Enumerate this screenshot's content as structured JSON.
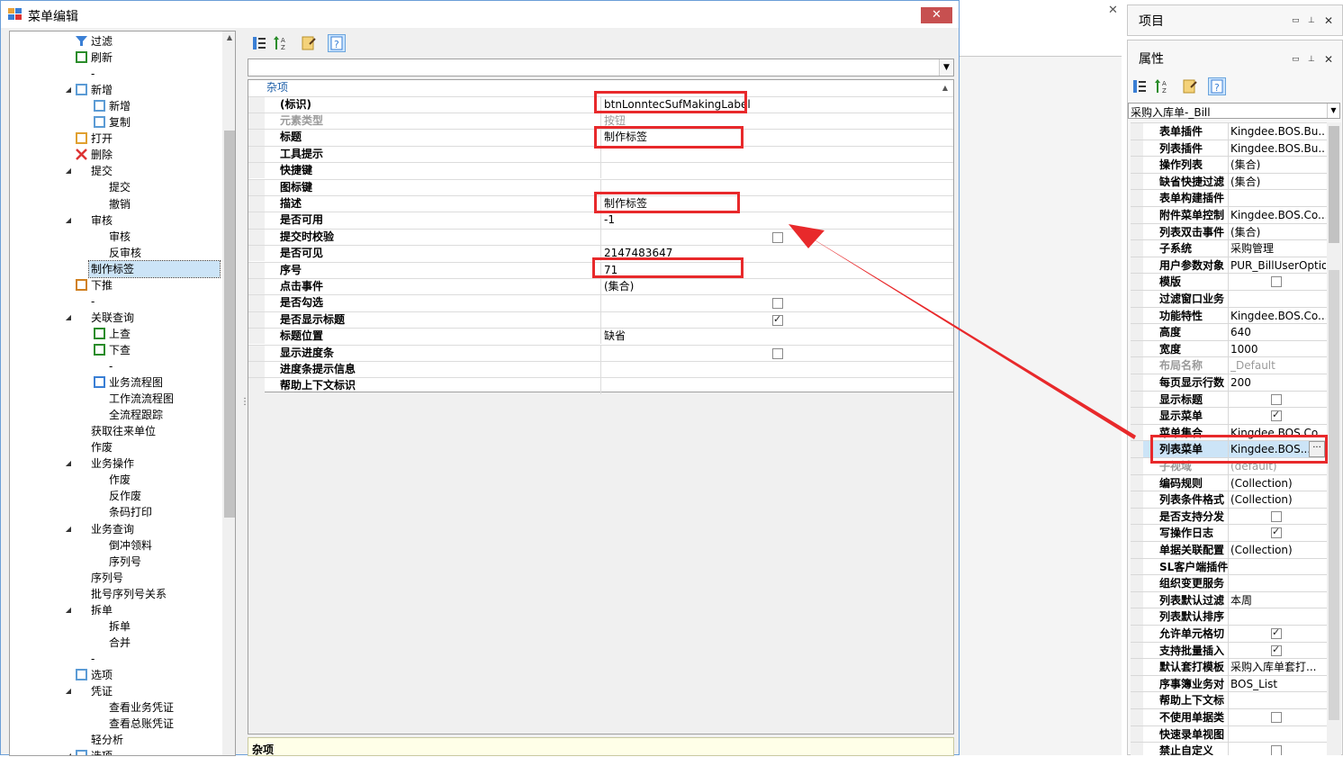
{
  "dialog": {
    "title": "菜单编辑",
    "close_label": "✕"
  },
  "tree": {
    "items": [
      {
        "label": "过滤",
        "indent": 1,
        "icon": "filter-icon",
        "expander": ""
      },
      {
        "label": "刷新",
        "indent": 1,
        "icon": "refresh-icon",
        "expander": ""
      },
      {
        "label": "-",
        "indent": 1,
        "icon": "",
        "expander": ""
      },
      {
        "label": "新增",
        "indent": 1,
        "icon": "new-doc-icon",
        "expander": "◢"
      },
      {
        "label": "新增",
        "indent": 2,
        "icon": "new-doc-icon",
        "expander": ""
      },
      {
        "label": "复制",
        "indent": 2,
        "icon": "copy-icon",
        "expander": ""
      },
      {
        "label": "打开",
        "indent": 1,
        "icon": "open-icon",
        "expander": ""
      },
      {
        "label": "删除",
        "indent": 1,
        "icon": "delete-icon",
        "expander": ""
      },
      {
        "label": "提交",
        "indent": 1,
        "icon": "",
        "expander": "◢"
      },
      {
        "label": "提交",
        "indent": 2,
        "icon": "",
        "expander": ""
      },
      {
        "label": "撤销",
        "indent": 2,
        "icon": "",
        "expander": ""
      },
      {
        "label": "审核",
        "indent": 1,
        "icon": "",
        "expander": "◢"
      },
      {
        "label": "审核",
        "indent": 2,
        "icon": "",
        "expander": ""
      },
      {
        "label": "反审核",
        "indent": 2,
        "icon": "",
        "expander": ""
      },
      {
        "label": "制作标签",
        "indent": 1,
        "icon": "",
        "expander": "",
        "selected": true
      },
      {
        "label": "下推",
        "indent": 1,
        "icon": "push-down-icon",
        "expander": ""
      },
      {
        "label": "-",
        "indent": 1,
        "icon": "",
        "expander": ""
      },
      {
        "label": "关联查询",
        "indent": 1,
        "icon": "",
        "expander": "◢"
      },
      {
        "label": "上查",
        "indent": 2,
        "icon": "up-query-icon",
        "expander": ""
      },
      {
        "label": "下查",
        "indent": 2,
        "icon": "down-query-icon",
        "expander": ""
      },
      {
        "label": "-",
        "indent": 2,
        "icon": "",
        "expander": ""
      },
      {
        "label": "业务流程图",
        "indent": 2,
        "icon": "flowchart-icon",
        "expander": ""
      },
      {
        "label": "工作流流程图",
        "indent": 2,
        "icon": "",
        "expander": ""
      },
      {
        "label": "全流程跟踪",
        "indent": 2,
        "icon": "",
        "expander": ""
      },
      {
        "label": "获取往来单位",
        "indent": 1,
        "icon": "",
        "expander": ""
      },
      {
        "label": "作废",
        "indent": 1,
        "icon": "",
        "expander": ""
      },
      {
        "label": "业务操作",
        "indent": 1,
        "icon": "",
        "expander": "◢"
      },
      {
        "label": "作废",
        "indent": 2,
        "icon": "",
        "expander": ""
      },
      {
        "label": "反作废",
        "indent": 2,
        "icon": "",
        "expander": ""
      },
      {
        "label": "条码打印",
        "indent": 2,
        "icon": "",
        "expander": ""
      },
      {
        "label": "业务查询",
        "indent": 1,
        "icon": "",
        "expander": "◢"
      },
      {
        "label": "倒冲领料",
        "indent": 2,
        "icon": "",
        "expander": ""
      },
      {
        "label": "序列号",
        "indent": 2,
        "icon": "",
        "expander": ""
      },
      {
        "label": "序列号",
        "indent": 1,
        "icon": "",
        "expander": ""
      },
      {
        "label": "批号序列号关系",
        "indent": 1,
        "icon": "",
        "expander": ""
      },
      {
        "label": "拆单",
        "indent": 1,
        "icon": "",
        "expander": "◢"
      },
      {
        "label": "拆单",
        "indent": 2,
        "icon": "",
        "expander": ""
      },
      {
        "label": "合并",
        "indent": 2,
        "icon": "",
        "expander": ""
      },
      {
        "label": "-",
        "indent": 1,
        "icon": "",
        "expander": ""
      },
      {
        "label": "选项",
        "indent": 1,
        "icon": "options-icon",
        "expander": ""
      },
      {
        "label": "凭证",
        "indent": 1,
        "icon": "",
        "expander": "◢"
      },
      {
        "label": "查看业务凭证",
        "indent": 2,
        "icon": "",
        "expander": ""
      },
      {
        "label": "查看总账凭证",
        "indent": 2,
        "icon": "",
        "expander": ""
      },
      {
        "label": "轻分析",
        "indent": 1,
        "icon": "",
        "expander": ""
      },
      {
        "label": "选项",
        "indent": 1,
        "icon": "options-icon",
        "expander": "◢"
      }
    ]
  },
  "editor": {
    "category": "杂项",
    "rows": [
      {
        "key": "(标识)",
        "value": "btnLonntecSufMakingLabel",
        "type": "text"
      },
      {
        "key": "元素类型",
        "value": "按钮",
        "type": "text",
        "dim": true
      },
      {
        "key": "标题",
        "value": "制作标签",
        "type": "text"
      },
      {
        "key": "工具提示",
        "value": "",
        "type": "text"
      },
      {
        "key": "快捷键",
        "value": "",
        "type": "text"
      },
      {
        "key": "图标键",
        "value": "",
        "type": "text"
      },
      {
        "key": "描述",
        "value": "制作标签",
        "type": "text"
      },
      {
        "key": "是否可用",
        "value": "-1",
        "type": "text"
      },
      {
        "key": "提交时校验",
        "value": "",
        "type": "check",
        "checked": false
      },
      {
        "key": "是否可见",
        "value": "2147483647",
        "type": "text"
      },
      {
        "key": "序号",
        "value": "71",
        "type": "text"
      },
      {
        "key": "点击事件",
        "value": "(集合)",
        "type": "text"
      },
      {
        "key": "是否勾选",
        "value": "",
        "type": "check",
        "checked": false
      },
      {
        "key": "是否显示标题",
        "value": "",
        "type": "check",
        "checked": true
      },
      {
        "key": "标题位置",
        "value": "缺省",
        "type": "text"
      },
      {
        "key": "显示进度条",
        "value": "",
        "type": "check",
        "checked": false
      },
      {
        "key": "进度条提示信息",
        "value": "",
        "type": "text"
      },
      {
        "key": "帮助上下文标识",
        "value": "",
        "type": "text"
      }
    ],
    "description_title": "杂项"
  },
  "project_panel": {
    "title": "项目"
  },
  "properties_panel": {
    "title": "属性",
    "object_combo": "采购入库单-_Bill",
    "rows": [
      {
        "key": "表单插件",
        "value": "Kingdee.BOS.Bu...",
        "type": "text"
      },
      {
        "key": "列表插件",
        "value": "Kingdee.BOS.Bu...",
        "type": "text"
      },
      {
        "key": "操作列表",
        "value": "(集合)",
        "type": "text"
      },
      {
        "key": "缺省快捷过滤",
        "value": "(集合)",
        "type": "text"
      },
      {
        "key": "表单构建插件",
        "value": "",
        "type": "text"
      },
      {
        "key": "附件菜单控制",
        "value": "Kingdee.BOS.Co...",
        "type": "text"
      },
      {
        "key": "列表双击事件",
        "value": "(集合)",
        "type": "text"
      },
      {
        "key": "子系统",
        "value": "采购管理",
        "type": "text"
      },
      {
        "key": "用户参数对象",
        "value": "PUR_BillUserOption",
        "type": "text"
      },
      {
        "key": "模版",
        "value": "",
        "type": "check",
        "checked": false
      },
      {
        "key": "过滤窗口业务",
        "value": "",
        "type": "text"
      },
      {
        "key": "功能特性",
        "value": "Kingdee.BOS.Co...",
        "type": "text"
      },
      {
        "key": "高度",
        "value": "640",
        "type": "text"
      },
      {
        "key": "宽度",
        "value": "1000",
        "type": "text"
      },
      {
        "key": "布局名称",
        "value": "_Default",
        "type": "text",
        "dim": true
      },
      {
        "key": "每页显示行数",
        "value": "200",
        "type": "text"
      },
      {
        "key": "显示标题",
        "value": "",
        "type": "check",
        "checked": false
      },
      {
        "key": "显示菜单",
        "value": "",
        "type": "check",
        "checked": true
      },
      {
        "key": "菜单集合",
        "value": "Kingdee.BOS.Co...",
        "type": "text"
      },
      {
        "key": "列表菜单",
        "value": "Kingdee.BOS...",
        "type": "text",
        "selected": true
      },
      {
        "key": "子视域",
        "value": "(default)",
        "type": "text",
        "dim": true
      },
      {
        "key": "编码规则",
        "value": "(Collection)",
        "type": "text"
      },
      {
        "key": "列表条件格式",
        "value": "(Collection)",
        "type": "text"
      },
      {
        "key": "是否支持分发",
        "value": "",
        "type": "check",
        "checked": false
      },
      {
        "key": "写操作日志",
        "value": "",
        "type": "check",
        "checked": true
      },
      {
        "key": "单据关联配置",
        "value": "(Collection)",
        "type": "text"
      },
      {
        "key": "SL客户端插件",
        "value": "",
        "type": "text"
      },
      {
        "key": "组织变更服务",
        "value": "",
        "type": "text"
      },
      {
        "key": "列表默认过滤",
        "value": "本周",
        "type": "text"
      },
      {
        "key": "列表默认排序",
        "value": "",
        "type": "text"
      },
      {
        "key": "允许单元格切",
        "value": "",
        "type": "check",
        "checked": true
      },
      {
        "key": "支持批量插入",
        "value": "",
        "type": "check",
        "checked": true
      },
      {
        "key": "默认套打模板",
        "value": "采购入库单套打...",
        "type": "text"
      },
      {
        "key": "序事簿业务对",
        "value": "BOS_List",
        "type": "text"
      },
      {
        "key": "帮助上下文标",
        "value": "",
        "type": "text"
      },
      {
        "key": "不使用单据类",
        "value": "",
        "type": "check",
        "checked": false
      },
      {
        "key": "快速录单视图",
        "value": "",
        "type": "text"
      },
      {
        "key": "禁止自定义",
        "value": "",
        "type": "check",
        "checked": false
      }
    ]
  },
  "colors": {
    "highlight": "#e8292b",
    "selection": "#cce4f7",
    "category_text": "#1e5fa8"
  }
}
